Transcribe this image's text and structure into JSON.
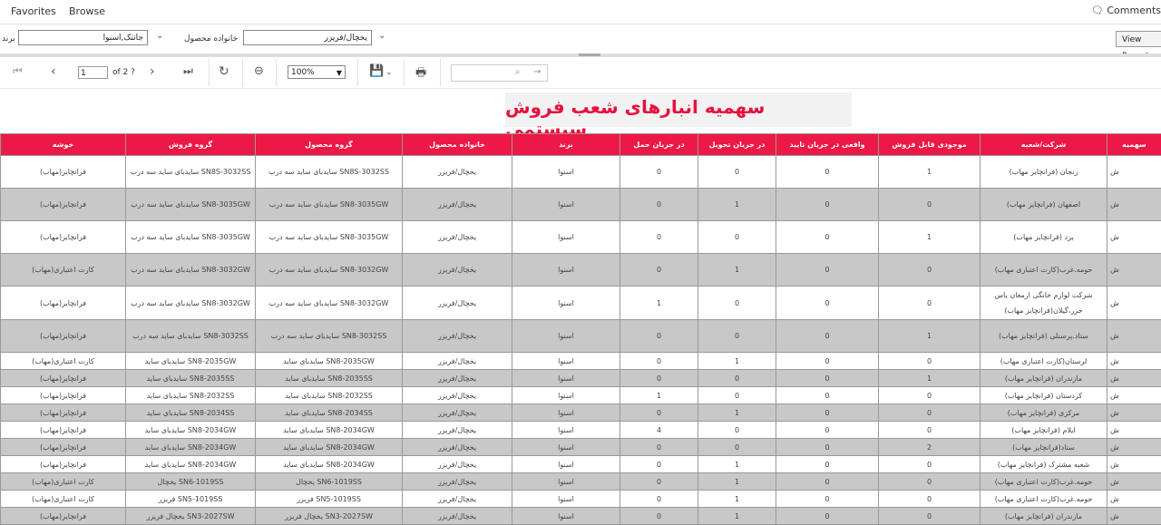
{
  "nav": {
    "favorites": "Favorites",
    "browse": "Browse",
    "comments": "Comments"
  },
  "params": {
    "brand_label": "برند",
    "brand_value": "جانتک,اسنوا",
    "family_label": "خانواده محصول",
    "family_value": "یخچال/فریزر",
    "view_report": "View Report"
  },
  "toolbar": {
    "page_value": "1",
    "page_of": "of 2 ?",
    "zoom": "100%"
  },
  "report": {
    "title": "سهمیه انبارهای شعب فروش سیستمی",
    "columns": [
      "خوشه",
      "گروه فروش",
      "گروه محصول",
      "خانواده محصول",
      "برند",
      "در جریان حمل",
      "در جریان تحویل",
      "واقعی در جریان تایید",
      "موجودی قابل فروش",
      "شرکت/شعبه",
      "سهمیه"
    ],
    "rows": [
      [
        "فرانچایز(مهاب)",
        "SN8S-3032SS سایدبای ساید سه درب",
        "SN8S-3032SS سایدبای ساید سه درب",
        "یخچال/فریزر",
        "اسنوا",
        "0",
        "0",
        "0",
        "1",
        "زنجان (فرانچایز مهاب)",
        "ش"
      ],
      [
        "فرانچایز(مهاب)",
        "SN8-3035GW سایدبای ساید سه درب",
        "SN8-3035GW سایدبای ساید سه درب",
        "یخچال/فریزر",
        "اسنوا",
        "0",
        "1",
        "0",
        "0",
        "اصفهان (فرانچایز مهاب)",
        "ش"
      ],
      [
        "فرانچایز(مهاب)",
        "SN8-3035GW سایدبای ساید سه درب",
        "SN8-3035GW سایدبای ساید سه درب",
        "یخچال/فریزر",
        "اسنوا",
        "0",
        "0",
        "0",
        "1",
        "یزد (فرانچایز مهاب)",
        "ش"
      ],
      [
        "کارت اعتباری(مهاب)",
        "SN8-3032GW سایدبای ساید سه درب",
        "SN8-3032GW سایدبای ساید سه درب",
        "یخچال/فریزر",
        "اسنوا",
        "0",
        "1",
        "0",
        "0",
        "حومه.غرب(کارت اعتباری مهاب)",
        "ش"
      ],
      [
        "فرانچایز(مهاب)",
        "SN8-3032GW سایدبای ساید سه درب",
        "SN8-3032GW سایدبای ساید سه درب",
        "یخچال/فریزر",
        "اسنوا",
        "1",
        "0",
        "0",
        "0",
        "شرکت لوازم خانگی ارمغان یاس خزر،گیلان(فرانچایز مهاب)",
        "ش"
      ],
      [
        "فرانچایز(مهاب)",
        "SN8-3032SS سایدبای ساید سه درب",
        "SN8-3032SS سایدبای ساید سه درب",
        "یخچال/فریزر",
        "اسنوا",
        "0",
        "0",
        "0",
        "1",
        "ستاد.پرسنلی (فرانچایز مهاب)",
        "ش"
      ],
      [
        "کارت اعتباری(مهاب)",
        "SN8-2035GW سایدبای ساید",
        "SN8-2035GW سایدبای ساید",
        "یخچال/فریزر",
        "اسنوا",
        "0",
        "1",
        "0",
        "0",
        "لرستان(کارت اعتباری مهاب)",
        "ش"
      ],
      [
        "فرانچایز(مهاب)",
        "SN8-2035SS سایدبای ساید",
        "SN8-2035SS سایدبای ساید",
        "یخچال/فریزر",
        "اسنوا",
        "0",
        "0",
        "0",
        "1",
        "مازندران (فرانچایز مهاب)",
        "ش"
      ],
      [
        "فرانچایز(مهاب)",
        "SN8-2032SS سایدبای ساید",
        "SN8-2032SS سایدبای ساید",
        "یخچال/فریزر",
        "اسنوا",
        "1",
        "0",
        "0",
        "0",
        "کردستان (فرانچایز مهاب)",
        "ش"
      ],
      [
        "فرانچایز(مهاب)",
        "SN8-2034SS سایدبای ساید",
        "SN8-2034SS سایدبای ساید",
        "یخچال/فریزر",
        "اسنوا",
        "0",
        "1",
        "0",
        "0",
        "مرکزی (فرانچایز مهاب)",
        "ش"
      ],
      [
        "فرانچایز(مهاب)",
        "SN8-2034GW سایدبای ساید",
        "SN8-2034GW سایدبای ساید",
        "یخچال/فریزر",
        "اسنوا",
        "4",
        "0",
        "0",
        "0",
        "ایلام (فرانچایز مهاب)",
        "ش"
      ],
      [
        "فرانچایز(مهاب)",
        "SN8-2034GW سایدبای ساید",
        "SN8-2034GW سایدبای ساید",
        "یخچال/فریزر",
        "اسنوا",
        "0",
        "0",
        "0",
        "2",
        "ستاد(فرانچایز مهاب)",
        "ش"
      ],
      [
        "فرانچایز(مهاب)",
        "SN8-2034GW سایدبای ساید",
        "SN8-2034GW سایدبای ساید",
        "یخچال/فریزر",
        "اسنوا",
        "0",
        "1",
        "0",
        "0",
        "شعبه مشترک (فرانچایز مهاب)",
        "ش"
      ],
      [
        "کارت اعتباری(مهاب)",
        "SN6-1019SS یخچال",
        "SN6-1019SS یخچال",
        "یخچال/فریزر",
        "اسنوا",
        "0",
        "1",
        "0",
        "0",
        "حومه.غرب(کارت اعتباری مهاب)",
        "ش"
      ],
      [
        "کارت اعتباری(مهاب)",
        "SN5-1019SS فریزر",
        "SN5-1019SS فریزر",
        "یخچال/فریزر",
        "اسنوا",
        "0",
        "1",
        "0",
        "0",
        "حومه.غرب(کارت اعتباری مهاب)",
        "ش"
      ],
      [
        "فرانچایز(مهاب)",
        "SN3-2027SW یخچال فریزر",
        "SN3-2027SW یخچال فریزر",
        "یخچال/فریزر",
        "اسنوا",
        "0",
        "1",
        "0",
        "0",
        "مازندران (فرانچایز مهاب)",
        "ش"
      ]
    ]
  }
}
